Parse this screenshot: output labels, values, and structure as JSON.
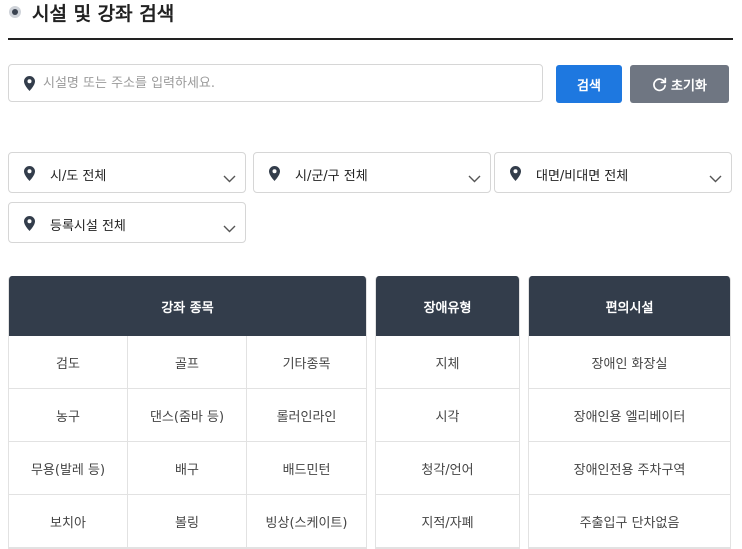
{
  "header": {
    "title": "시설 및 강좌 검색"
  },
  "search": {
    "placeholder": "시설명 또는 주소를 입력하세요.",
    "value": "",
    "search_label": "검색",
    "reset_label": "초기화"
  },
  "filters": {
    "region": "시/도 전체",
    "district": "시/군/구 전체",
    "mode": "대면/비대면 전체",
    "registered": "등록시설 전체"
  },
  "panels": {
    "sports": {
      "title": "강좌 종목",
      "items": [
        "검도",
        "골프",
        "기타종목",
        "농구",
        "댄스(줌바 등)",
        "롤러인라인",
        "무용(발레 등)",
        "배구",
        "배드민턴",
        "보치아",
        "볼링",
        "빙상(스케이트)"
      ]
    },
    "disability": {
      "title": "장애유형",
      "items": [
        "지체",
        "시각",
        "청각/언어",
        "지적/자폐"
      ]
    },
    "amenities": {
      "title": "편의시설",
      "items": [
        "장애인 화장실",
        "장애인용 엘리베이터",
        "장애인전용 주차구역",
        "주출입구 단차없음"
      ]
    }
  },
  "colors": {
    "primary": "#1e78e0",
    "secondary": "#6f7682",
    "header_bg": "#333d4b"
  }
}
